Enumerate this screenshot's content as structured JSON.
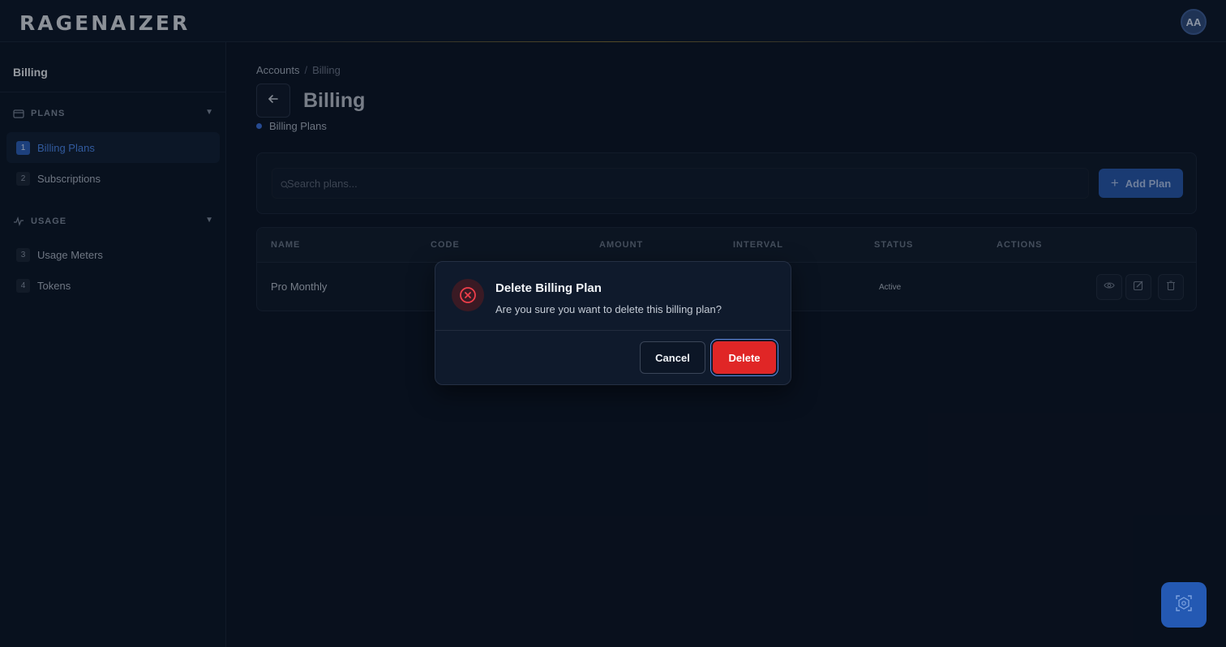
{
  "header": {
    "logo": "RAGENAIZER",
    "avatar_initials": "AA"
  },
  "sidebar": {
    "title": "Billing",
    "sections": [
      {
        "label": "PLANS",
        "items": [
          {
            "num": "1",
            "label": "Billing Plans",
            "active": true
          },
          {
            "num": "2",
            "label": "Subscriptions",
            "active": false
          }
        ]
      },
      {
        "label": "USAGE",
        "items": [
          {
            "num": "3",
            "label": "Usage Meters",
            "active": false
          },
          {
            "num": "4",
            "label": "Tokens",
            "active": false
          }
        ]
      }
    ]
  },
  "main": {
    "breadcrumb": [
      "Accounts",
      "Billing"
    ],
    "breadcrumb_sep": "/",
    "title": "Billing",
    "subtitle": "Billing Plans",
    "search_placeholder": "Search plans...",
    "add_button": "Add Plan",
    "table": {
      "columns": [
        "NAME",
        "CODE",
        "AMOUNT",
        "INTERVAL",
        "STATUS",
        "ACTIONS"
      ],
      "rows": [
        {
          "name": "Pro Monthly",
          "status": "Active"
        }
      ]
    }
  },
  "dialog": {
    "title": "Delete Billing Plan",
    "message": "Are you sure you want to delete this billing plan?",
    "cancel": "Cancel",
    "delete": "Delete"
  },
  "colors": {
    "background": "#0b1424",
    "accent": "#2c5fb5",
    "danger": "#e02626",
    "active_text": "#4a86e8"
  },
  "icons": [
    "arrow-left-icon",
    "search-icon",
    "plus-icon",
    "credit-card-icon",
    "activity-icon",
    "chevron-down-icon",
    "eye-icon",
    "edit-icon",
    "trash-icon",
    "x-circle-icon",
    "assistant-icon"
  ]
}
